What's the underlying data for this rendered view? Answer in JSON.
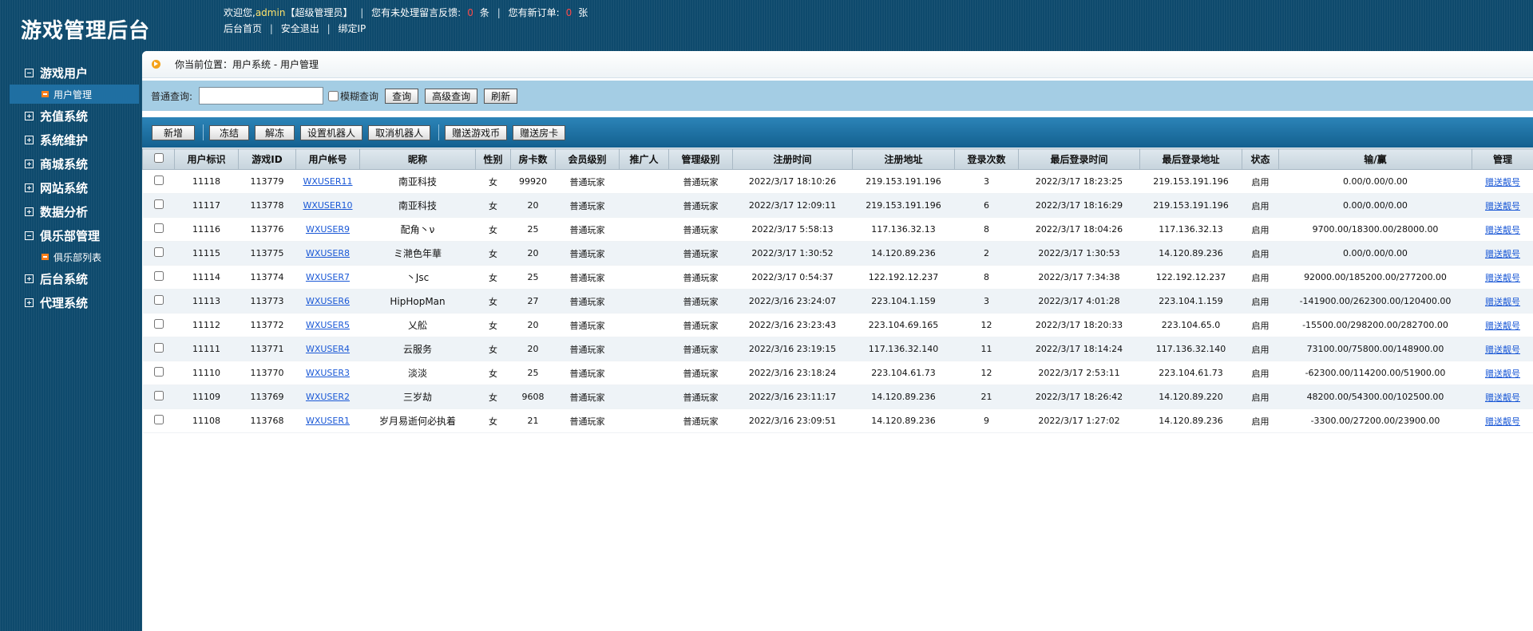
{
  "header": {
    "title": "游戏管理后台",
    "welcome_prefix": "欢迎您,",
    "user": "admin",
    "role": "【超级管理员】",
    "feedback_label": "您有未处理留言反馈:",
    "feedback_count": "0",
    "feedback_unit": "条",
    "orders_label": "您有新订单:",
    "orders_count": "0",
    "orders_unit": "张",
    "links": [
      "后台首页",
      "安全退出",
      "绑定IP"
    ]
  },
  "sidebar": {
    "groups": [
      {
        "label": "游戏用户",
        "expanded": true,
        "children": [
          "用户管理"
        ]
      },
      {
        "label": "充值系统",
        "expanded": false
      },
      {
        "label": "系统维护",
        "expanded": false
      },
      {
        "label": "商城系统",
        "expanded": false
      },
      {
        "label": "网站系统",
        "expanded": false
      },
      {
        "label": "数据分析",
        "expanded": false
      },
      {
        "label": "俱乐部管理",
        "expanded": true,
        "children": [
          "俱乐部列表"
        ]
      },
      {
        "label": "后台系统",
        "expanded": false
      },
      {
        "label": "代理系统",
        "expanded": false
      }
    ]
  },
  "location": "你当前位置：用户系统 - 用户管理",
  "search": {
    "label": "普通查询:",
    "value": "",
    "fuzzy_label": "模糊查询",
    "query_btn": "查询",
    "advanced_btn": "高级查询",
    "refresh_btn": "刷新"
  },
  "toolbar": {
    "add": "新增",
    "freeze": "冻结",
    "unfreeze": "解冻",
    "set_robot": "设置机器人",
    "cancel_robot": "取消机器人",
    "gift_coin": "赠送游戏币",
    "gift_card": "赠送房卡"
  },
  "table": {
    "columns": [
      "用户标识",
      "游戏ID",
      "用户帐号",
      "昵称",
      "性别",
      "房卡数",
      "会员级别",
      "推广人",
      "管理级别",
      "注册时间",
      "注册地址",
      "登录次数",
      "最后登录时间",
      "最后登录地址",
      "状态",
      "输/赢",
      "管理"
    ],
    "action_label": "赠送靓号",
    "rows": [
      [
        "11118",
        "113779",
        "WXUSER11",
        "南亚科技",
        "女",
        "99920",
        "普通玩家",
        "",
        "普通玩家",
        "2022/3/17 18:10:26",
        "219.153.191.196",
        "3",
        "2022/3/17 18:23:25",
        "219.153.191.196",
        "启用",
        "0.00/0.00/0.00"
      ],
      [
        "11117",
        "113778",
        "WXUSER10",
        "南亚科技",
        "女",
        "20",
        "普通玩家",
        "",
        "普通玩家",
        "2022/3/17 12:09:11",
        "219.153.191.196",
        "6",
        "2022/3/17 18:16:29",
        "219.153.191.196",
        "启用",
        "0.00/0.00/0.00"
      ],
      [
        "11116",
        "113776",
        "WXUSER9",
        "配角丶ν",
        "女",
        "25",
        "普通玩家",
        "",
        "普通玩家",
        "2022/3/17 5:58:13",
        "117.136.32.13",
        "8",
        "2022/3/17 18:04:26",
        "117.136.32.13",
        "启用",
        "9700.00/18300.00/28000.00"
      ],
      [
        "11115",
        "113775",
        "WXUSER8",
        "ミ滟色年華",
        "女",
        "20",
        "普通玩家",
        "",
        "普通玩家",
        "2022/3/17 1:30:52",
        "14.120.89.236",
        "2",
        "2022/3/17 1:30:53",
        "14.120.89.236",
        "启用",
        "0.00/0.00/0.00"
      ],
      [
        "11114",
        "113774",
        "WXUSER7",
        "丶Jsc",
        "女",
        "25",
        "普通玩家",
        "",
        "普通玩家",
        "2022/3/17 0:54:37",
        "122.192.12.237",
        "8",
        "2022/3/17 7:34:38",
        "122.192.12.237",
        "启用",
        "92000.00/185200.00/277200.00"
      ],
      [
        "11113",
        "113773",
        "WXUSER6",
        "HipHopMan",
        "女",
        "27",
        "普通玩家",
        "",
        "普通玩家",
        "2022/3/16 23:24:07",
        "223.104.1.159",
        "3",
        "2022/3/17 4:01:28",
        "223.104.1.159",
        "启用",
        "-141900.00/262300.00/120400.00"
      ],
      [
        "11112",
        "113772",
        "WXUSER5",
        "乂舩",
        "女",
        "20",
        "普通玩家",
        "",
        "普通玩家",
        "2022/3/16 23:23:43",
        "223.104.69.165",
        "12",
        "2022/3/17 18:20:33",
        "223.104.65.0",
        "启用",
        "-15500.00/298200.00/282700.00"
      ],
      [
        "11111",
        "113771",
        "WXUSER4",
        "云服务",
        "女",
        "20",
        "普通玩家",
        "",
        "普通玩家",
        "2022/3/16 23:19:15",
        "117.136.32.140",
        "11",
        "2022/3/17 18:14:24",
        "117.136.32.140",
        "启用",
        "73100.00/75800.00/148900.00"
      ],
      [
        "11110",
        "113770",
        "WXUSER3",
        "淡淡",
        "女",
        "25",
        "普通玩家",
        "",
        "普通玩家",
        "2022/3/16 23:18:24",
        "223.104.61.73",
        "12",
        "2022/3/17 2:53:11",
        "223.104.61.73",
        "启用",
        "-62300.00/114200.00/51900.00"
      ],
      [
        "11109",
        "113769",
        "WXUSER2",
        "三岁劫",
        "女",
        "9608",
        "普通玩家",
        "",
        "普通玩家",
        "2022/3/16 23:11:17",
        "14.120.89.236",
        "21",
        "2022/3/17 18:26:42",
        "14.120.89.220",
        "启用",
        "48200.00/54300.00/102500.00"
      ],
      [
        "11108",
        "113768",
        "WXUSER1",
        "岁月易逝何必执着",
        "女",
        "21",
        "普通玩家",
        "",
        "普通玩家",
        "2022/3/16 23:09:51",
        "14.120.89.236",
        "9",
        "2022/3/17 1:27:02",
        "14.120.89.236",
        "启用",
        "-3300.00/27200.00/23900.00"
      ]
    ]
  }
}
